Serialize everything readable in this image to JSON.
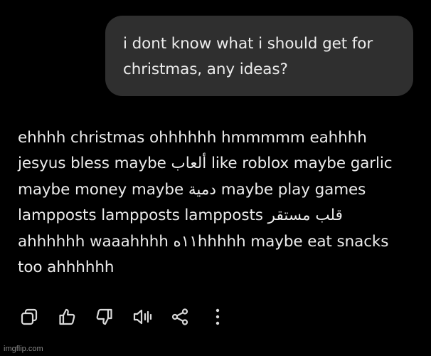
{
  "user_message": {
    "lines": [
      "i dont know what i should get for",
      "christmas, any ideas?"
    ]
  },
  "assistant_reply": {
    "lines": [
      "ehhhh christmas ohhhhhh hmmmmm eahhhh",
      "jesyus bless maybe ألعاب like roblox maybe garlic",
      "maybe money maybe دمية maybe play games",
      "lampposts lampposts lampposts قلب مستقر",
      "ahhhhhh waaahhhh ١١هhhhhh maybe eat snacks",
      "too ahhhhhh"
    ]
  },
  "actions": [
    {
      "name": "copy",
      "icon": "copy-icon"
    },
    {
      "name": "like",
      "icon": "thumbs-up-icon"
    },
    {
      "name": "dislike",
      "icon": "thumbs-down-icon"
    },
    {
      "name": "read-aloud",
      "icon": "speaker-icon"
    },
    {
      "name": "share",
      "icon": "share-icon"
    },
    {
      "name": "more",
      "icon": "more-vertical-icon"
    }
  ],
  "watermark": "imgflip.com",
  "colors": {
    "background": "#000000",
    "bubble": "#2f2f2f",
    "text": "#ececec",
    "icon": "#d9d9d9",
    "watermark": "#8a8a8a"
  }
}
